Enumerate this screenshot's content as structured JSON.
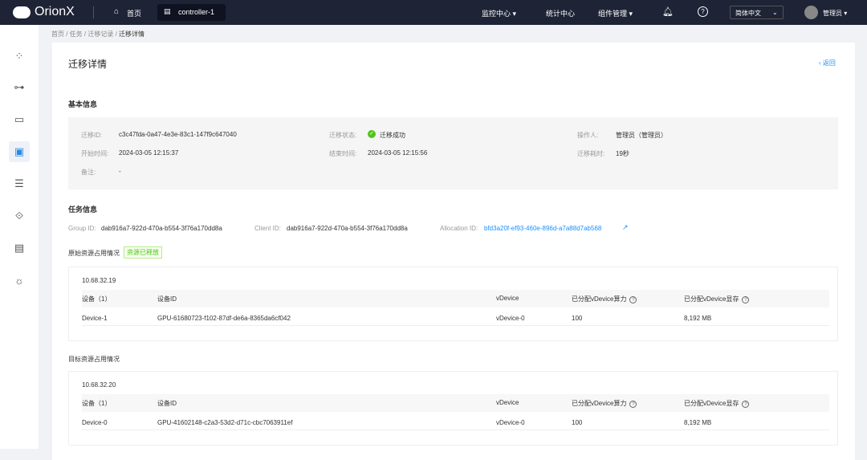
{
  "header": {
    "logo": "OrionX",
    "home": "首页",
    "tab": "controller-1",
    "nav": [
      "监控中心",
      "统计中心",
      "组件管理"
    ],
    "lang": "简体中文",
    "user": "管理员"
  },
  "breadcrumb": [
    "首页",
    "任务",
    "迁移记录",
    "迁移详情"
  ],
  "page": {
    "title": "迁移详情",
    "back": "返回"
  },
  "basic": {
    "title": "基本信息",
    "fields": [
      {
        "label": "迁移ID:",
        "value": "c3c47fda-0a47-4e3e-83c1-147f9c647040"
      },
      {
        "label": "迁移状态:",
        "value": "迁移成功"
      },
      {
        "label": "操作人:",
        "value": "管理员（管理员）"
      },
      {
        "label": "开始时间:",
        "value": "2024-03-05 12:15:37"
      },
      {
        "label": "结束时间:",
        "value": "2024-03-05 12:15:56"
      },
      {
        "label": "迁移耗时:",
        "value": "19秒"
      },
      {
        "label": "备注:",
        "value": "-"
      }
    ]
  },
  "task": {
    "title": "任务信息",
    "group_label": "Group ID:",
    "group": "dab916a7-922d-470a-b554-3f76a170dd8a",
    "client_label": "Client ID:",
    "client": "dab916a7-922d-470a-b554-3f76a170dd8a",
    "alloc_label": "Allocation ID:",
    "alloc": "bfd3a20f-ef93-460e-896d-a7a88d7ab568"
  },
  "colors": {
    "accent": "#1890ff",
    "success": "#52c41a",
    "header": "#1e2336"
  },
  "columns": [
    "设备（1）",
    "设备ID",
    "vDevice",
    "已分配vDevice算力",
    "已分配vDevice显存"
  ],
  "source": {
    "title": "原始资源占用情况",
    "badge": "资源已释放",
    "ip": "10.68.32.19",
    "row": [
      "Device-1",
      "GPU-61680723-f102-87df-de6a-8365da6cf042",
      "vDevice-0",
      "100",
      "8,192 MB"
    ]
  },
  "target": {
    "title": "目标资源占用情况",
    "ip": "10.68.32.20",
    "row": [
      "Device-0",
      "GPU-41602148-c2a3-53d2-d71c-cbc7063911ef",
      "vDevice-0",
      "100",
      "8,192 MB"
    ]
  }
}
